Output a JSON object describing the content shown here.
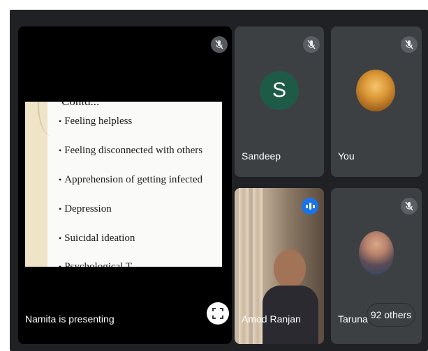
{
  "presentation": {
    "heading": "Contd...",
    "bullets": [
      "Feeling helpless",
      "Feeling disconnected with others",
      "Apprehension of getting infected",
      "Depression",
      "Suicidal ideation",
      "Psychological T..."
    ],
    "presenter_label": "Namita is presenting"
  },
  "participants": [
    {
      "name": "Sandeep",
      "avatar_letter": "S",
      "mic": "muted",
      "avatar_color": "#1e5b47"
    },
    {
      "name": "You",
      "mic": "muted"
    },
    {
      "name": "Amod Ranjan",
      "mic": "speaking"
    },
    {
      "name": "Taruna",
      "mic": "muted"
    }
  ],
  "others": {
    "label": "92 others"
  },
  "icons": {
    "mic_off": "mic-off-icon",
    "fullscreen": "fullscreen-icon",
    "speaking": "audio-level-icon",
    "collapse": "chevron-left-icon"
  },
  "colors": {
    "background": "#202124",
    "tile": "#3c4043",
    "speaking": "#1a73e8"
  }
}
